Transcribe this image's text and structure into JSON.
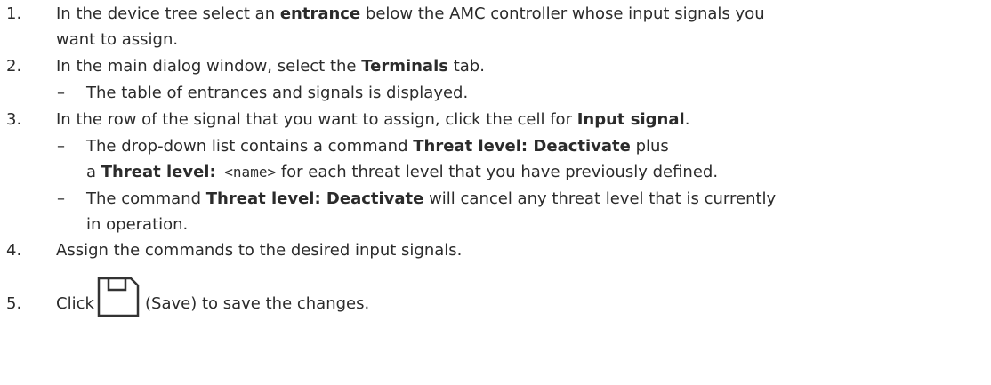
{
  "steps": [
    {
      "number": "1.",
      "line1": {
        "pre": "In the device tree select an ",
        "bold": "entrance",
        "post": " below the AMC controller whose input signals you"
      },
      "line2": "want to assign."
    },
    {
      "number": "2.",
      "pre": "In the main dialog window, select the ",
      "bold": "Terminals",
      "post": " tab.",
      "result": {
        "dash": "–",
        "text": "The table of entrances and signals is displayed."
      }
    },
    {
      "number": "3.",
      "pre": "In the row of the signal that you want to assign, click the cell for ",
      "bold": "Input signal",
      "post": ".",
      "result1": {
        "dash": "–",
        "line1": {
          "pre": "The drop-down list contains a command ",
          "bold": "Threat level: Deactivate",
          "post": " plus"
        },
        "line2": {
          "pre": "a ",
          "bold": "Threat level:",
          "mono": " <name>",
          "post": " for each threat level that you have previously defined."
        }
      },
      "result2": {
        "dash": "–",
        "line1": {
          "pre": "The command ",
          "bold": "Threat level: Deactivate",
          "post": " will cancel any threat level that is currently"
        },
        "line2": "in operation."
      }
    },
    {
      "number": "4.",
      "text": "Assign the commands to the desired input signals."
    },
    {
      "number": "5.",
      "pre": "Click",
      "icon": "save-icon",
      "post": "(Save) to save the changes."
    }
  ]
}
